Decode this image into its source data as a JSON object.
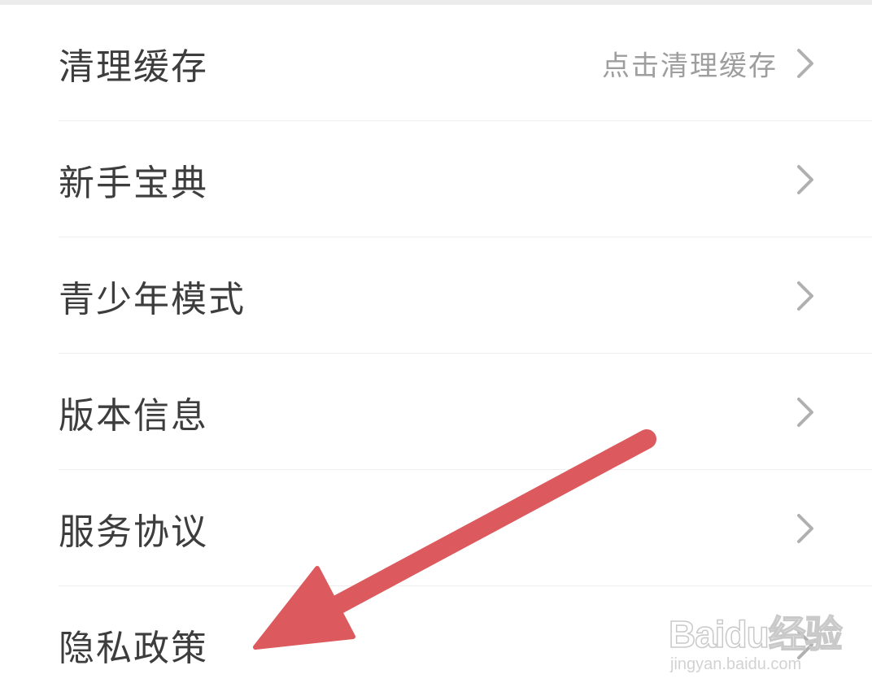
{
  "settings": {
    "items": [
      {
        "label": "清理缓存",
        "hint": "点击清理缓存",
        "icon": "chevron-right-icon"
      },
      {
        "label": "新手宝典",
        "hint": "",
        "icon": "chevron-right-icon"
      },
      {
        "label": "青少年模式",
        "hint": "",
        "icon": "chevron-right-icon"
      },
      {
        "label": "版本信息",
        "hint": "",
        "icon": "chevron-right-icon"
      },
      {
        "label": "服务协议",
        "hint": "",
        "icon": "chevron-right-icon"
      },
      {
        "label": "隐私政策",
        "hint": "",
        "icon": "chevron-right-icon"
      }
    ]
  },
  "annotation": {
    "type": "arrow",
    "color": "#dc5a5e",
    "points_to": "隐私政策"
  },
  "watermark": {
    "logo": "Baidu经验",
    "url": "jingyan.baidu.com"
  },
  "colors": {
    "label": "#3d3d3d",
    "hint": "#9e9e9e",
    "chevron": "#b0b0b0",
    "divider": "#eeeeee"
  }
}
